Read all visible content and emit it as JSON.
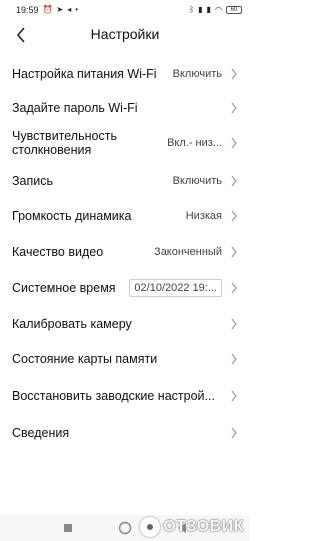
{
  "status_bar": {
    "time": "19:59",
    "battery": "60"
  },
  "header": {
    "title": "Настройки"
  },
  "settings": [
    {
      "label": "Настройка питания Wi-Fi",
      "value": "Включить"
    },
    {
      "label": "Задайте пароль Wi-Fi",
      "value": ""
    },
    {
      "label": "Чувствительность столкновения",
      "value": "Вкл.- низ..."
    },
    {
      "label": "Запись",
      "value": "Включить"
    },
    {
      "label": "Громкость динамика",
      "value": "Низкая"
    },
    {
      "label": "Качество видео",
      "value": "Законченный"
    },
    {
      "label": "Системное время",
      "value": "02/10/2022 19:..."
    },
    {
      "label": "Калибровать камеру",
      "value": ""
    },
    {
      "label": "Состояние карты памяти",
      "value": ""
    },
    {
      "label": "Восстановить заводские настрой...",
      "value": ""
    },
    {
      "label": "Сведения",
      "value": ""
    }
  ],
  "watermark": {
    "text": "ОТЗОВИК"
  },
  "colors": {
    "chevron": "#9a9a9a",
    "nav_icon": "#888888"
  }
}
